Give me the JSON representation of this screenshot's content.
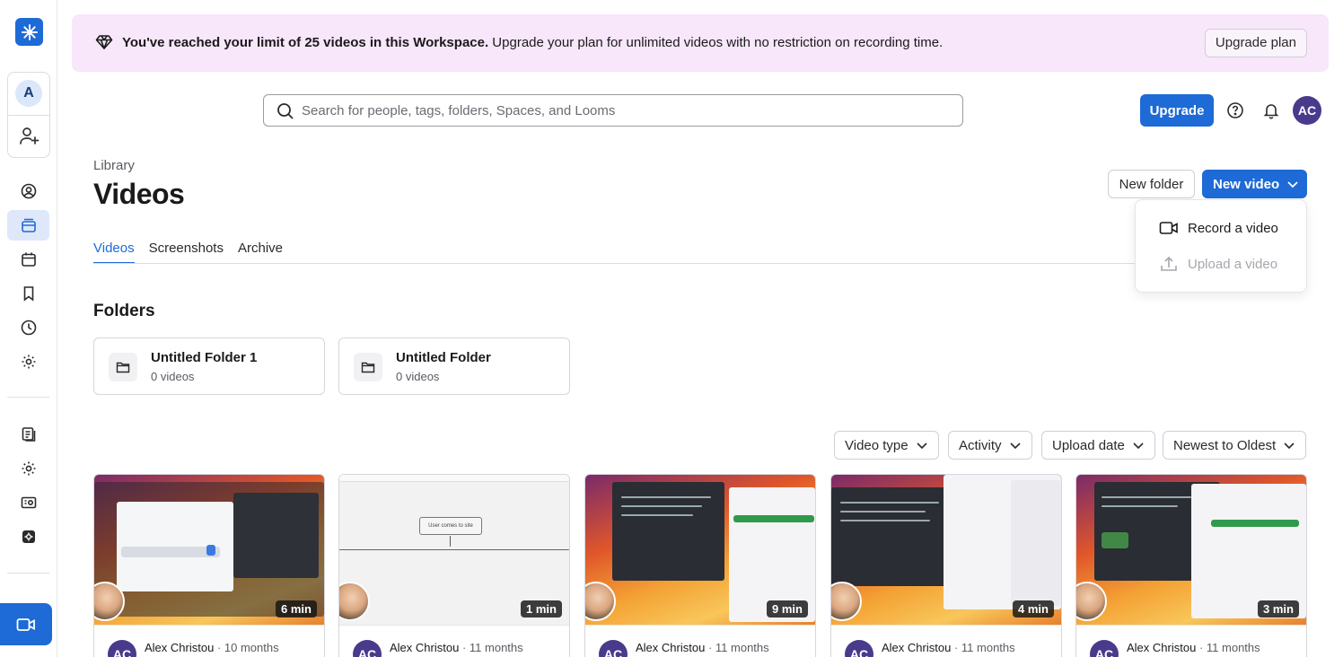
{
  "banner": {
    "bold_text": "You've reached your limit of 25 videos in this Workspace.",
    "text": " Upgrade your plan for unlimited videos with no restriction on recording time.",
    "button_label": "Upgrade plan"
  },
  "sidebar": {
    "workspace_initial": "A",
    "icons": [
      "profile-icon",
      "library-icon",
      "calendar-icon",
      "bookmark-icon",
      "history-icon",
      "settings-icon",
      "document-icon",
      "gear-icon",
      "screen-icon",
      "settings-small-icon"
    ]
  },
  "header": {
    "search_placeholder": "Search for people, tags, folders, Spaces, and Looms",
    "upgrade_label": "Upgrade",
    "user_initials": "AC"
  },
  "page": {
    "breadcrumb": "Library",
    "title": "Videos",
    "new_folder_label": "New folder",
    "new_video_label": "New video"
  },
  "tabs": [
    "Videos",
    "Screenshots",
    "Archive"
  ],
  "menu": {
    "record_label": "Record a video",
    "upload_label": "Upload a video"
  },
  "folders": {
    "title": "Folders",
    "items": [
      {
        "name": "Untitled Folder 1",
        "count": "0 videos"
      },
      {
        "name": "Untitled Folder",
        "count": "0 videos"
      }
    ]
  },
  "filters": [
    "Video type",
    "Activity",
    "Upload date",
    "Newest to Oldest"
  ],
  "videos": [
    {
      "duration": "6 min",
      "author": "Alex Christou",
      "when": "10 months",
      "initials": "AC"
    },
    {
      "duration": "1 min",
      "author": "Alex Christou",
      "when": "11 months",
      "initials": "AC"
    },
    {
      "duration": "9 min",
      "author": "Alex Christou",
      "when": "11 months",
      "initials": "AC"
    },
    {
      "duration": "4 min",
      "author": "Alex Christou",
      "when": "11 months",
      "initials": "AC"
    },
    {
      "duration": "3 min",
      "author": "Alex Christou",
      "when": "11 months",
      "initials": "AC"
    }
  ],
  "video_thumb_diagram_label": "User comes to site",
  "colors": {
    "accent": "#1e6ad6",
    "banner_bg": "#f8e6fa",
    "avatar": "#4a3a8c"
  }
}
